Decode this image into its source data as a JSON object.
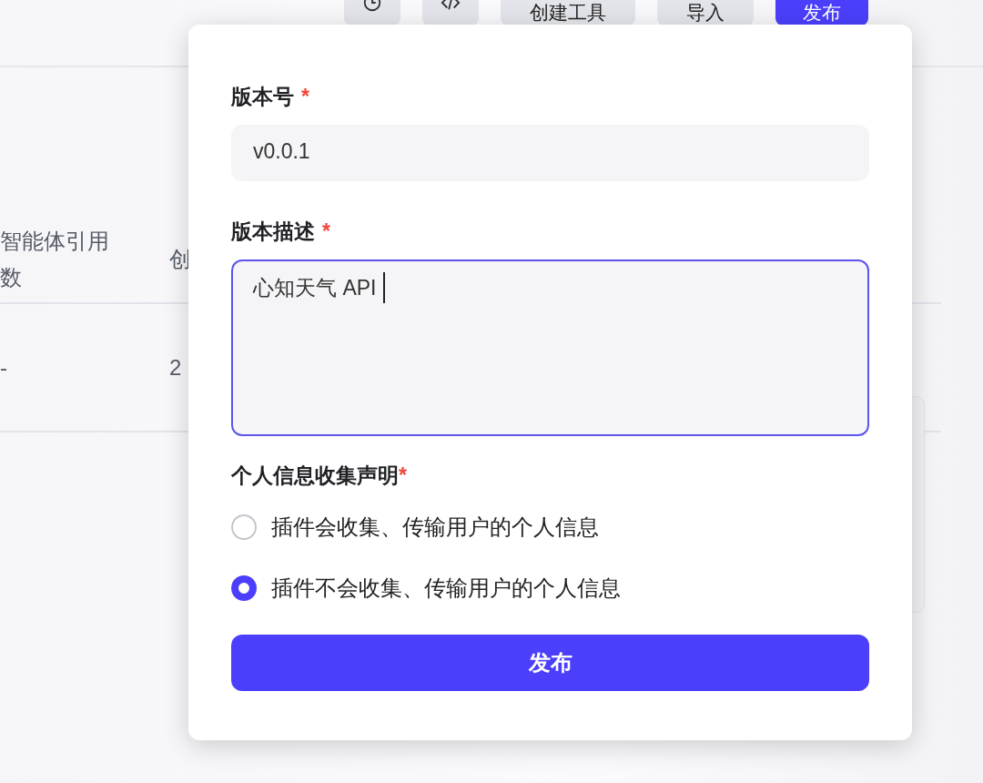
{
  "toolbar": {
    "buttons": [
      {
        "kind": "history",
        "primary": false
      },
      {
        "kind": "code",
        "primary": false
      },
      {
        "kind": "text",
        "label": "创建工具",
        "primary": false
      },
      {
        "kind": "text",
        "label": "导入",
        "primary": false
      },
      {
        "kind": "text",
        "label": "发布",
        "primary": true
      }
    ]
  },
  "table": {
    "columns": [
      "智能体引用数",
      "创"
    ],
    "rows": [
      [
        "-",
        "2"
      ]
    ]
  },
  "dialog": {
    "fields": [
      {
        "kind": "input",
        "label": "版本号",
        "required_mark": "*",
        "value": "v0.0.1",
        "focused": false
      },
      {
        "kind": "textarea",
        "label": "版本描述",
        "required_mark": "*",
        "value": "心知天气 API",
        "focused": true
      }
    ],
    "consent": {
      "label": "个人信息收集声明",
      "required_mark": "*",
      "options": [
        {
          "label": "插件会收集、传输用户的个人信息",
          "selected": false
        },
        {
          "label": "插件不会收集、传输用户的个人信息",
          "selected": true
        }
      ]
    },
    "submit": "发布"
  }
}
